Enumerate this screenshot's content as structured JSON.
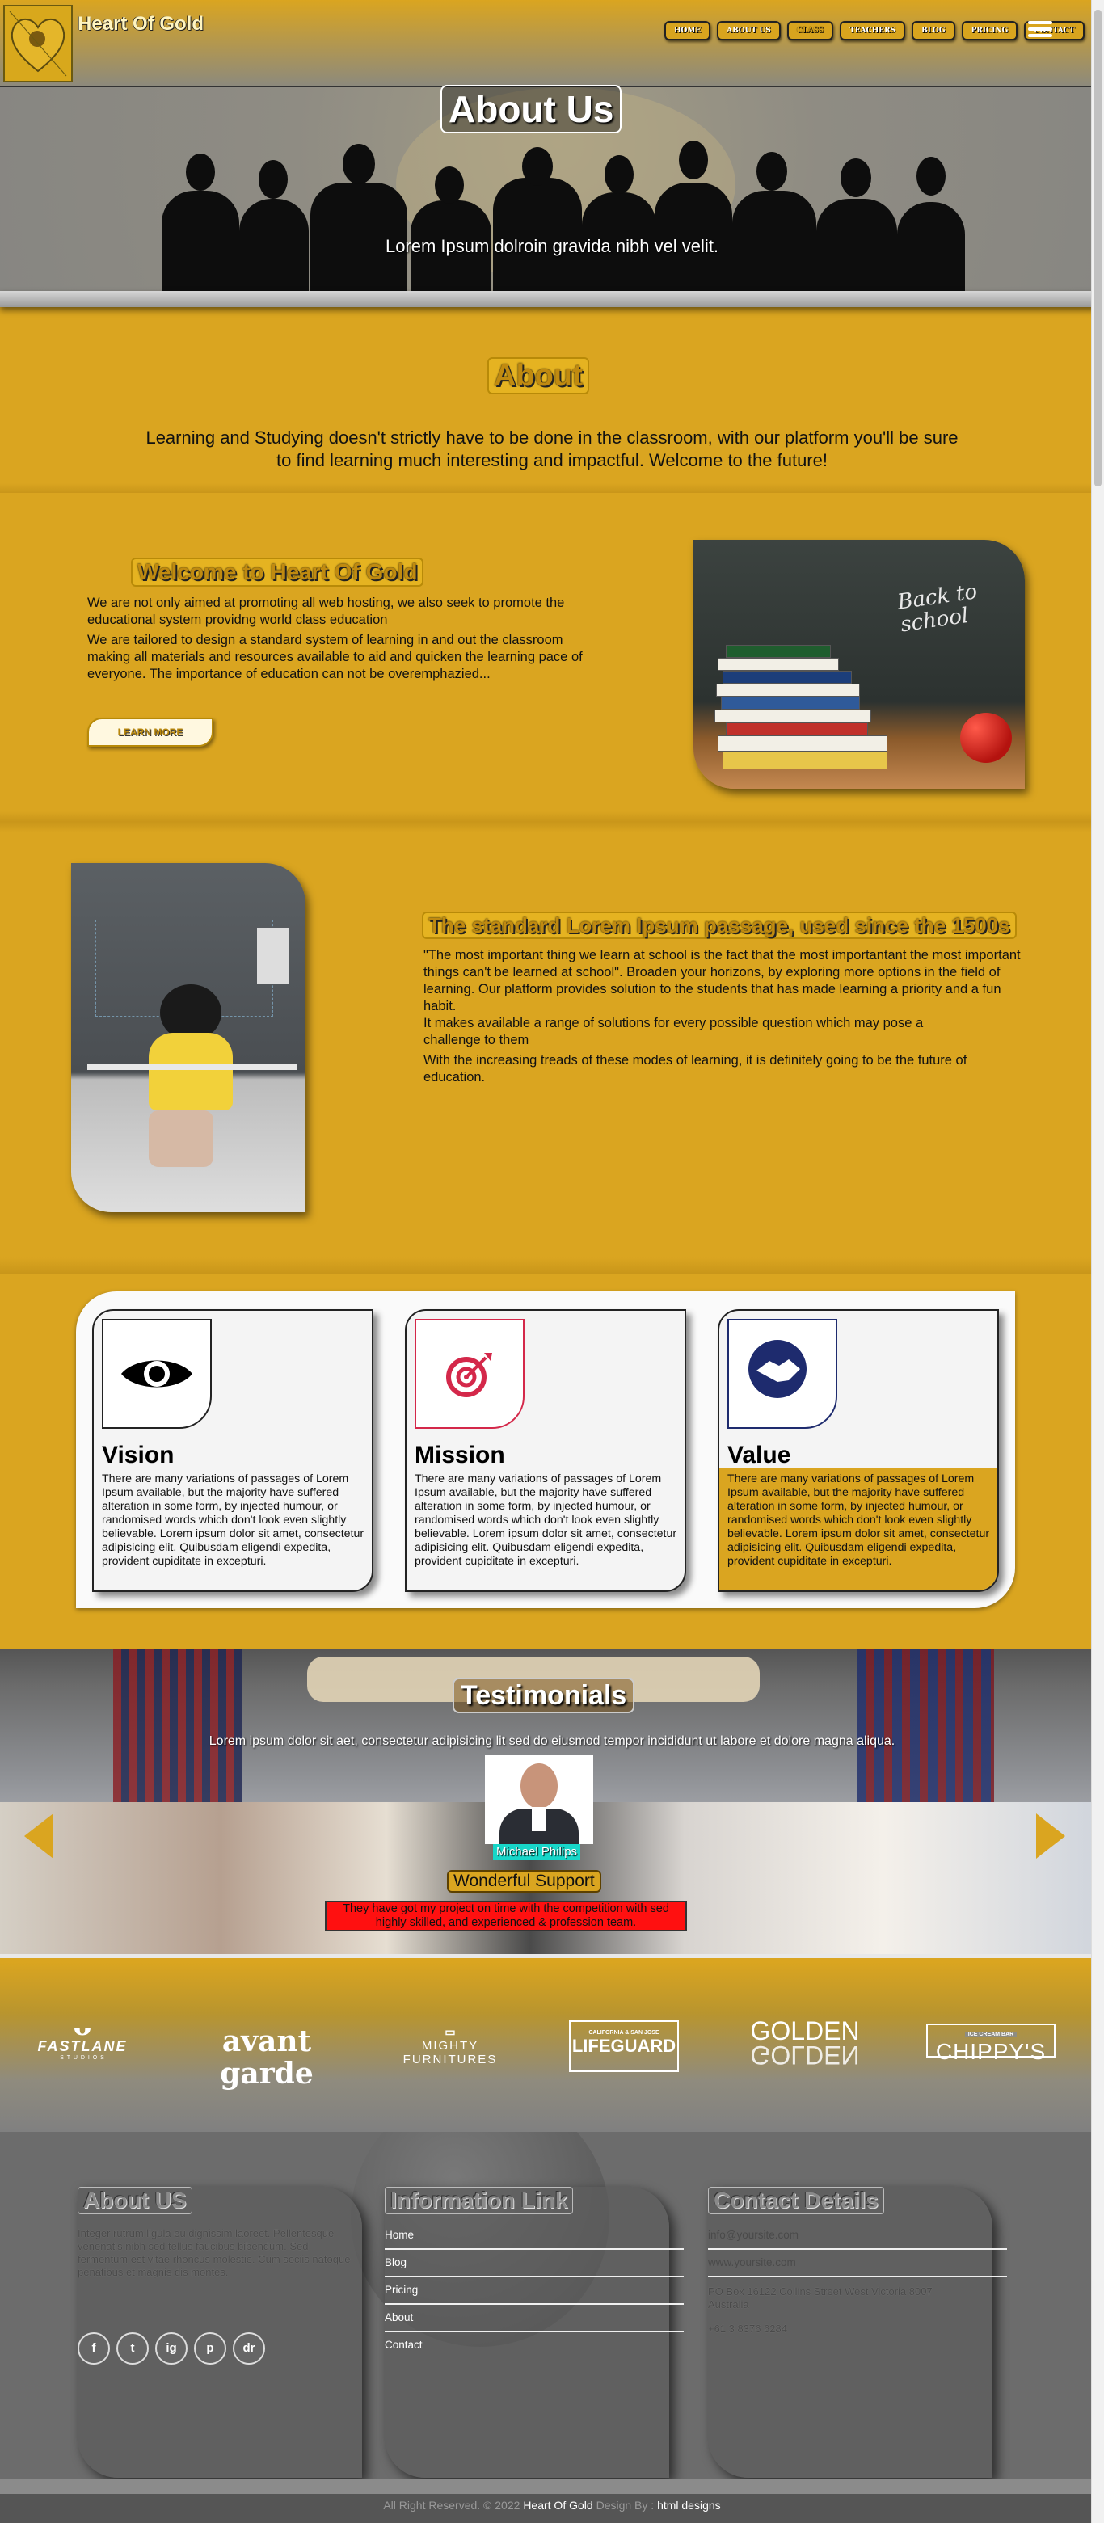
{
  "header": {
    "brand": "Heart Of Gold",
    "nav": [
      "HOME",
      "ABOUT US",
      "CLASS",
      "TEACHERS",
      "BLOG",
      "PRICING",
      "CONTACT"
    ]
  },
  "hero": {
    "title": "About Us",
    "subtitle": "Lorem Ipsum dolroin gravida nibh vel velit."
  },
  "about": {
    "title": "About",
    "text": "Learning and Studying doesn't strictly have to be done in the classroom, with our platform you'll be sure to find learning much interesting and impactful. Welcome to the future!"
  },
  "welcome": {
    "title": "Welcome to Heart Of Gold",
    "p1": "We are not only aimed at promoting all web hosting, we also seek to promote the educational system providng world class education",
    "p2": "We are tailored to design a standard system of learning in and out the classroom making all materials and resources available to aid and quicken the learning pace of everyone. The importance of education can not be overemphazied...",
    "button": "LEARN MORE",
    "image_text": "Back to school"
  },
  "standard": {
    "title": "The standard Lorem Ipsum passage, used since the 1500s",
    "p1": "\"The most important thing we learn at school is the fact that the most importantant the most important things can't be learned at school\". Broaden your horizons, by exploring more options in the field of learning. Our platform provides solution to the students that has made learning a priority and a fun habit.",
    "p2": "It makes available a range of solutions for every possible question which may pose a challenge to them",
    "p3": "With the increasing treads of these modes of learning, it is definitely going to be the future of education."
  },
  "cards": [
    {
      "title": "Vision",
      "icon": "eye-icon",
      "text": "There are many variations of passages of Lorem Ipsum available, but the majority have suffered alteration in some form, by injected humour, or randomised words which don't look even slightly believable. Lorem ipsum dolor sit amet, consectetur adipisicing elit. Quibusdam eligendi expedita, provident cupiditate in excepturi."
    },
    {
      "title": "Mission",
      "icon": "target-icon",
      "text": "There are many variations of passages of Lorem Ipsum available, but the majority have suffered alteration in some form, by injected humour, or randomised words which don't look even slightly believable. Lorem ipsum dolor sit amet, consectetur adipisicing elit. Quibusdam eligendi expedita, provident cupiditate in excepturi."
    },
    {
      "title": "Value",
      "icon": "handshake-icon",
      "text": "There are many variations of passages of Lorem Ipsum available, but the majority have suffered alteration in some form, by injected humour, or randomised words which don't look even slightly believable. Lorem ipsum dolor sit amet, consectetur adipisicing elit. Quibusdam eligendi expedita, provident cupiditate in excepturi."
    }
  ],
  "testimonials": {
    "title": "Testimonials",
    "subtitle": "Lorem ipsum dolor sit aet, consectetur adipisicing lit sed do eiusmod tempor incididunt ut labore et dolore magna aliqua.",
    "name": "Michael Philips",
    "role": "Wonderful Support",
    "quote": "They have got my project on time with the competition with sed highly skilled, and experienced & profession team."
  },
  "brands": [
    "FASTLANE",
    "avant garde",
    "MIGHTY FURNITURES",
    "LIFEGUARD",
    "GOLDEN",
    "CHIPPY'S"
  ],
  "brand_subs": {
    "lifeguard_top": "CALIFORNIA & SAN JOSE",
    "chippys_top": "ICE CREAM BAR",
    "fastlane_sub": "S T U D I O S"
  },
  "footer": {
    "about_title": "About US",
    "about_text": "Integer rutrum ligula eu dignissim laoreet. Pellentesque venenatis nibh sed tellus faucibus bibendum. Sed fermentum est vitae rhoncus molestie. Cum sociis natoque penatibus et magnis dis montes.",
    "links_title": "Information Link",
    "links": [
      "Home",
      "Blog",
      "Pricing",
      "About",
      "Contact"
    ],
    "contact_title": "Contact Details",
    "email": "info@yoursite.com",
    "website": "www.yoursite.com",
    "address": "PO Box 16122 Collins Street West Victoria 8007 Australia",
    "phone": "+61 3 8376 6284",
    "social": [
      "f",
      "t",
      "ig",
      "p",
      "dr"
    ]
  },
  "copyright": {
    "prefix": "All Right Reserved. © 2022",
    "brand": "Heart Of Gold",
    "middle": "Design By :",
    "designer": "html designs"
  }
}
